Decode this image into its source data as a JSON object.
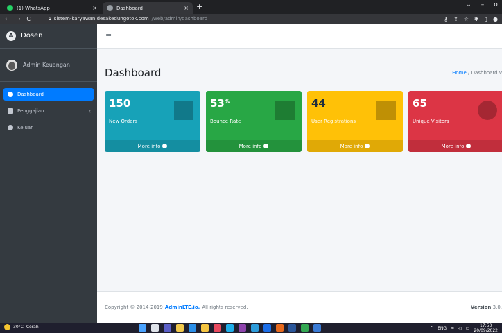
{
  "browser": {
    "tabs": [
      {
        "title": "(1) WhatsApp",
        "color": "#25d366"
      },
      {
        "title": "Dashboard",
        "color": "#9aa0a6"
      }
    ],
    "close_glyph": "×",
    "new_tab_glyph": "+",
    "window_controls": [
      "⌄",
      "–",
      "σ",
      "✕"
    ],
    "nav": [
      "←",
      "→",
      "C"
    ],
    "url_host": "sistem-karyawan.desakedungotok.com",
    "url_path": "/web/admin/dashboard"
  },
  "sidebar": {
    "brand": "Dosen",
    "user": "Admin Keuangan",
    "items": [
      {
        "label": "Dashboard",
        "active": true
      },
      {
        "label": "Penggajian",
        "active": false
      },
      {
        "label": "Keluar",
        "active": false
      }
    ]
  },
  "header": {
    "menu_glyph": "≡"
  },
  "content": {
    "title": "Dashboard",
    "breadcrumb": {
      "home": "Home",
      "sep": "/",
      "current": "Dashboard v"
    }
  },
  "boxes": [
    {
      "value": "150",
      "sup": "",
      "label": "New Orders",
      "footer": "More info",
      "color": "#17a2b8",
      "icon": "shopping-bag-icon"
    },
    {
      "value": "53",
      "sup": "%",
      "label": "Bounce Rate",
      "footer": "More info",
      "color": "#28a745",
      "icon": "stats-bars-icon"
    },
    {
      "value": "44",
      "sup": "",
      "label": "User Registrations",
      "footer": "More info",
      "color": "#ffc107",
      "icon": "person-add-icon"
    },
    {
      "value": "65",
      "sup": "",
      "label": "Unique Visitors",
      "footer": "More info",
      "color": "#dc3545",
      "icon": "pie-graph-icon"
    }
  ],
  "footer": {
    "copyright_prefix": "Copyright © 2014-2019",
    "link": "AdminLTE.io.",
    "suffix": "All rights reserved.",
    "version_label": "Version",
    "version": "3.0."
  },
  "taskbar": {
    "temp": "30°C",
    "weather": "Cerah",
    "lang": "ENG",
    "time": "17:53",
    "date": "20/09/2022"
  }
}
